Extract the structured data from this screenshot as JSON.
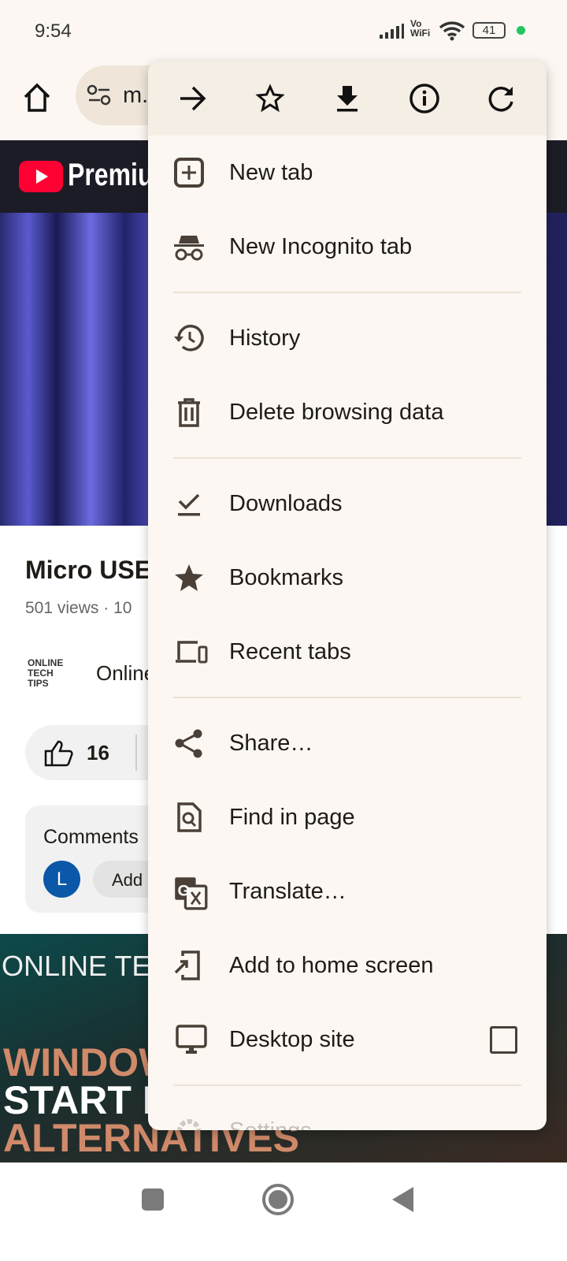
{
  "status": {
    "time": "9:54",
    "vowifi": "Vo WiFi",
    "battery": "41",
    "dot_color": "#22c55e"
  },
  "toolbar": {
    "url": "m."
  },
  "page": {
    "yt_brand": "Premiu",
    "video_title": "Micro USE",
    "video_meta": "501 views · 10",
    "channel_logo": "ONLINE TECH TIPS",
    "channel": "Online",
    "likes": "16",
    "comments": "Comments",
    "comment_avatar": "L",
    "add_comment": "Add",
    "thumb_top": "ONLINE TE",
    "thumb_l1": "WINDOW",
    "thumb_l2": "START I",
    "thumb_l3": "ALTERNATIVES",
    "accent": "#ff0033"
  },
  "menu": {
    "top_icons": [
      "forward-icon",
      "bookmark-star-icon",
      "download-icon",
      "info-icon",
      "reload-icon"
    ],
    "items": [
      {
        "label": "New tab",
        "icon": "new-tab-icon"
      },
      {
        "label": "New Incognito tab",
        "icon": "incognito-icon"
      },
      {
        "label": "History",
        "icon": "history-icon"
      },
      {
        "label": "Delete browsing data",
        "icon": "trash-icon"
      },
      {
        "label": "Downloads",
        "icon": "downloads-icon"
      },
      {
        "label": "Bookmarks",
        "icon": "star-icon"
      },
      {
        "label": "Recent tabs",
        "icon": "devices-icon"
      },
      {
        "label": "Share…",
        "icon": "share-icon"
      },
      {
        "label": "Find in page",
        "icon": "find-icon"
      },
      {
        "label": "Translate…",
        "icon": "translate-icon"
      },
      {
        "label": "Add to home screen",
        "icon": "add-home-icon"
      },
      {
        "label": "Desktop site",
        "icon": "desktop-icon",
        "checked": false
      },
      {
        "label": "Settings",
        "icon": "gear-icon"
      }
    ]
  }
}
